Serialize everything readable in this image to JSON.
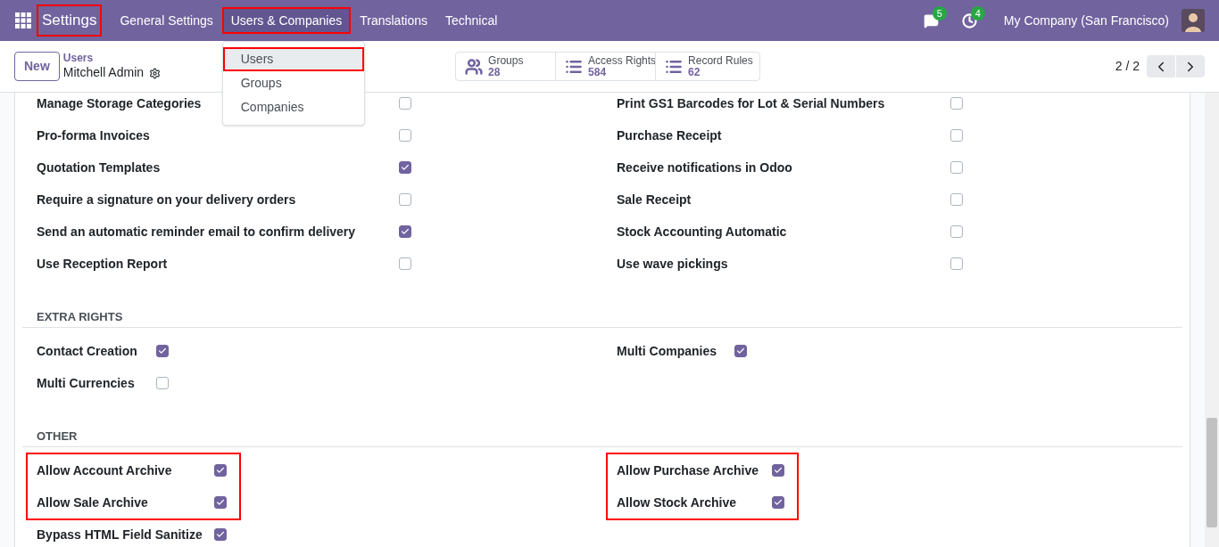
{
  "navbar": {
    "app_name": {
      "text": "Settings",
      "highlighted": true
    },
    "menu": [
      {
        "label": "General Settings",
        "highlighted": false,
        "open": false
      },
      {
        "label": "Users & Companies",
        "highlighted": true,
        "open": true
      },
      {
        "label": "Translations",
        "highlighted": false,
        "open": false
      },
      {
        "label": "Technical",
        "highlighted": false,
        "open": false
      }
    ],
    "dropdown": [
      {
        "label": "Users",
        "selected": true,
        "highlighted": true
      },
      {
        "label": "Groups",
        "selected": false,
        "highlighted": false
      },
      {
        "label": "Companies",
        "selected": false,
        "highlighted": false
      }
    ],
    "messages_badge": "5",
    "activities_badge": "4",
    "company": "My Company (San Francisco)"
  },
  "control_panel": {
    "new_button": "New",
    "breadcrumb": "Users",
    "record": "Mitchell Admin",
    "smart_buttons": [
      {
        "kind": "groups",
        "label": "Groups",
        "count": "28"
      },
      {
        "kind": "list",
        "label": "Access Rights",
        "count": "584"
      },
      {
        "kind": "list",
        "label": "Record Rules",
        "count": "62"
      }
    ],
    "pager": "2 / 2"
  },
  "sections": [
    {
      "columns": [
        [
          {
            "label": "Manage Storage Categories",
            "checked": false,
            "highlighted": false
          },
          {
            "label": "Pro-forma Invoices",
            "checked": false,
            "highlighted": false
          },
          {
            "label": "Quotation Templates",
            "checked": true,
            "highlighted": false
          },
          {
            "label": "Require a signature on your delivery orders",
            "checked": false,
            "highlighted": false
          },
          {
            "label": "Send an automatic reminder email to confirm delivery",
            "checked": true,
            "highlighted": false
          },
          {
            "label": "Use Reception Report",
            "checked": false,
            "highlighted": false
          }
        ],
        [
          {
            "label": "Print GS1 Barcodes for Lot & Serial Numbers",
            "checked": false,
            "highlighted": false
          },
          {
            "label": "Purchase Receipt",
            "checked": false,
            "highlighted": false
          },
          {
            "label": "Receive notifications in Odoo",
            "checked": false,
            "highlighted": false
          },
          {
            "label": "Sale Receipt",
            "checked": false,
            "highlighted": false
          },
          {
            "label": "Stock Accounting Automatic",
            "checked": false,
            "highlighted": false
          },
          {
            "label": "Use wave pickings",
            "checked": false,
            "highlighted": false
          }
        ]
      ]
    },
    {
      "title": "EXTRA RIGHTS",
      "columns": [
        [
          {
            "label": "Contact Creation",
            "checked": true,
            "highlighted": false
          },
          {
            "label": "Multi Currencies",
            "checked": false,
            "highlighted": false
          }
        ],
        [
          {
            "label": "Multi Companies",
            "checked": true,
            "highlighted": false
          }
        ]
      ]
    },
    {
      "title": "OTHER",
      "columns": [
        [
          {
            "label": "Allow Account Archive",
            "checked": true,
            "highlighted": true
          },
          {
            "label": "Allow Sale Archive",
            "checked": true,
            "highlighted": true
          },
          {
            "label": "Bypass HTML Field Sanitize",
            "checked": true,
            "highlighted": false
          }
        ],
        [
          {
            "label": "Allow Purchase Archive",
            "checked": true,
            "highlighted": true
          },
          {
            "label": "Allow Stock Archive",
            "checked": true,
            "highlighted": true
          }
        ]
      ]
    }
  ]
}
